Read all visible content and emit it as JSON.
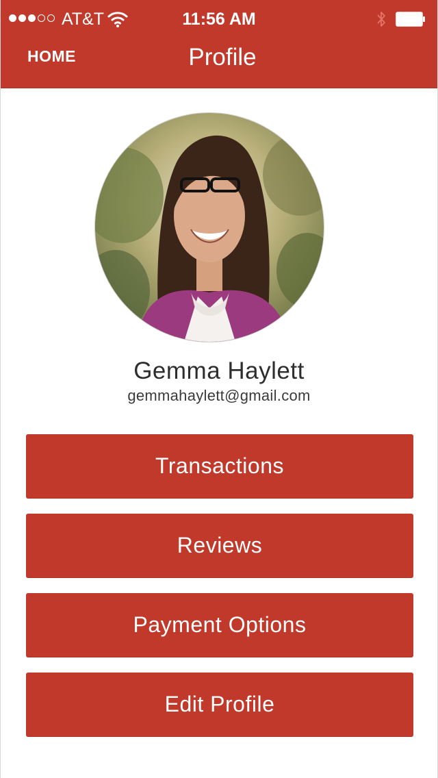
{
  "status_bar": {
    "signal": {
      "filled": 3,
      "total": 5
    },
    "carrier": "AT&T",
    "time": "11:56 AM",
    "icons": [
      "wifi-icon",
      "bluetooth-icon",
      "battery-icon"
    ]
  },
  "nav": {
    "home_label": "HOME",
    "title": "Profile"
  },
  "profile": {
    "name": "Gemma Haylett",
    "email": "gemmahaylett@gmail.com"
  },
  "menu": [
    {
      "label": "Transactions"
    },
    {
      "label": "Reviews"
    },
    {
      "label": "Payment Options"
    },
    {
      "label": "Edit Profile"
    }
  ],
  "colors": {
    "accent": "#c0392b",
    "text_dark": "#2e2e2e",
    "background": "#ffffff"
  }
}
